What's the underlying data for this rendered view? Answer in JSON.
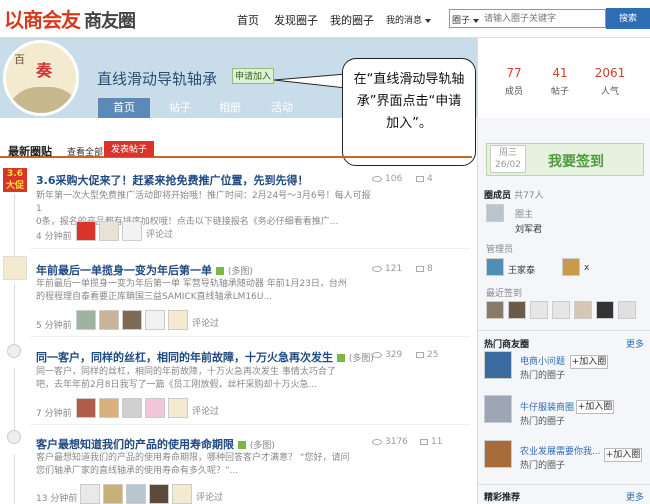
{
  "header": {
    "logo_main": "以商会友",
    "logo_sub": "商友圈",
    "nav": [
      "首页",
      "发现圈子",
      "我的圈子",
      "我的消息"
    ],
    "search_category": "圈子",
    "search_placeholder": "请输入圈子关键字",
    "search_button": "搜索"
  },
  "group": {
    "avatar_text_1": "百",
    "avatar_text_2": "奏",
    "name": "直线滑动导轨轴承",
    "join_label": "申请加入",
    "tabs": [
      "首页",
      "帖子",
      "相册",
      "活动"
    ]
  },
  "callout": {
    "text": "在“直线滑动导轨轴承”界面点击“申请加入”。"
  },
  "stats": [
    {
      "value": "77",
      "label": "成员"
    },
    {
      "value": "41",
      "label": "帖子"
    },
    {
      "value": "2061",
      "label": "人气"
    }
  ],
  "feed": {
    "title": "最新圈贴",
    "view_all": "查看全部",
    "post_button": "发表帖子",
    "comment_label": "评论过",
    "posts": [
      {
        "title": "3.6采购大促来了！赶紧来抢免费推广位置，先到先得！",
        "tag": "",
        "body_1": "新年第一次大型免费推广活动即将开始哦！推广时间：2月24号～3月6号！每人可报1",
        "body_2": "0条，报名的产品都有排序加权哦！点击以下链接报名《务必仔细看看推广...",
        "time": "4 分钟前",
        "views": "106",
        "comments": "4"
      },
      {
        "title": "年前最后一单揽身一变为年后第一单",
        "tag": "(多图)",
        "body_1": "年前最后一单揽身一变为年后第一单   军营导轨轴承随动器       年前1月23日，台州",
        "body_2": "的程程理自泰看要正库聃国三益SAMICK直线轴承LM16U...",
        "time": "5 分钟前",
        "views": "121",
        "comments": "8"
      },
      {
        "title": "同一客户，同样的丝杠，相同的年前故障，十万火急再次发生",
        "tag": "(多图)",
        "body_1": "同一客户，同样的丝杠，相同的年前故障，十万火急再次发生          事情太巧合了",
        "body_2": "吧，去年年前2月8日我写了一篇《员工刚放假，丝杆采购却十万火急...",
        "time": "7 分钟前",
        "views": "329",
        "comments": "25"
      },
      {
        "title": "客户最想知道我们的产品的使用寿命期限",
        "tag": "(多图)",
        "body_1": "客户最想知道我们的产品的使用寿命期限，哪种回答客户才满意？       “您好，请问",
        "body_2": "您们轴承厂家的直线轴承的使用寿命有多久呢？”...",
        "time": "13 分钟前",
        "views": "3176",
        "comments": "11"
      }
    ]
  },
  "sidebar": {
    "sign_day": "周三",
    "sign_date": "26/02",
    "sign_label": "我要签到",
    "members_title": "圈成员",
    "members_count": "共77人",
    "owner_label": "圈主",
    "owner_name": "刘军君",
    "admin_label": "管理员",
    "admins": [
      "王家泰",
      "x"
    ],
    "recent_label": "最近签到",
    "hot_title": "热门商友圈",
    "more": "更多",
    "hot_groups": [
      {
        "name": "电商小问题",
        "sub": "热门的圈子",
        "btn": "+加入圈"
      },
      {
        "name": "牛仔服装商圈",
        "sub": "热门的圈子",
        "btn": "+加入圈"
      },
      {
        "name": "农业发展需要你我...",
        "sub": "热门的圈子",
        "btn": "+加入圈"
      }
    ],
    "recommend_title": "精彩推荐",
    "recommend_more": "更多"
  },
  "colors": {
    "brand_red": "#d93a1c",
    "link_blue": "#1f4a82",
    "banner": "#c9dcea",
    "tab_active": "#5d89b7",
    "stat_red": "#d04030",
    "sign_green": "#4f9a3e"
  }
}
